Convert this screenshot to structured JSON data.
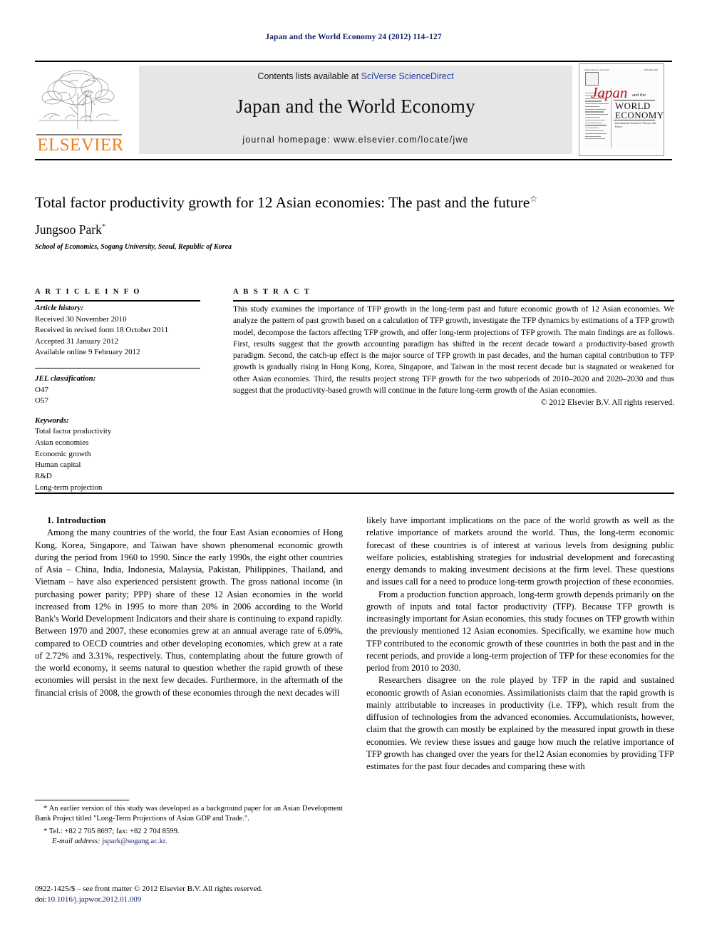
{
  "running_head": "Japan and the World Economy 24 (2012) 114–127",
  "masthead": {
    "contents_prefix": "Contents lists available at ",
    "contents_link": "SciVerse ScienceDirect",
    "journal_title": "Japan and the World Economy",
    "homepage": "journal homepage: www.elsevier.com/locate/jwe",
    "publisher_word": "ELSEVIER",
    "publisher_color": "#f07f1a",
    "link_color": "#2b3f9e",
    "cover": {
      "issue_line_left": "Volume 24  Issue 2  June 2012",
      "issue_line_right": "ISSN 0922-1425",
      "title_script": "Japan",
      "title_andthe": "and the",
      "title_world": "WORLD",
      "title_economy": "ECONOMY",
      "title_sub": "International Journal of Theory and Policy",
      "script_color": "#b5121b"
    }
  },
  "article": {
    "title": "Total factor productivity growth for 12 Asian economies: The past and the future",
    "title_marker": "☆",
    "author": "Jungsoo Park",
    "author_marker": "*",
    "affiliation": "School of Economics, Sogang University, Seoul, Republic of Korea"
  },
  "info": {
    "header": "A R T I C L E   I N F O",
    "history_label": "Article history:",
    "history": [
      "Received 30 November 2010",
      "Received in revised form 18 October 2011",
      "Accepted 31 January 2012",
      "Available online 9 February 2012"
    ],
    "jel_label": "JEL classification:",
    "jel": [
      "O47",
      "O57"
    ],
    "keywords_label": "Keywords:",
    "keywords": [
      "Total factor productivity",
      "Asian economies",
      "Economic growth",
      "Human capital",
      "R&D",
      "Long-term projection"
    ]
  },
  "abstract": {
    "header": "A B S T R A C T",
    "text": "This study examines the importance of TFP growth in the long-term past and future economic growth of 12 Asian economies. We analyze the pattern of past growth based on a calculation of TFP growth, investigate the TFP dynamics by estimations of a TFP growth model, decompose the factors affecting TFP growth, and offer long-term projections of TFP growth. The main findings are as follows. First, results suggest that the growth accounting paradigm has shifted in the recent decade toward a productivity-based growth paradigm. Second, the catch-up effect is the major source of TFP growth in past decades, and the human capital contribution to TFP growth is gradually rising in Hong Kong, Korea, Singapore, and Taiwan in the most recent decade but is stagnated or weakened for other Asian economies. Third, the results project strong TFP growth for the two subperiods of 2010–2020 and 2020–2030 and thus suggest that the productivity-based growth will continue in the future long-term growth of the Asian economies.",
    "copyright": "© 2012 Elsevier B.V. All rights reserved."
  },
  "body": {
    "section_heading": "1. Introduction",
    "left_paragraphs": [
      "Among the many countries of the world, the four East Asian economies of Hong Kong, Korea, Singapore, and Taiwan have shown phenomenal economic growth during the period from 1960 to 1990. Since the early 1990s, the eight other countries of Asia – China, India, Indonesia, Malaysia, Pakistan, Philippines, Thailand, and Vietnam – have also experienced persistent growth. The gross national income (in purchasing power parity; PPP) share of these 12 Asian economies in the world increased from 12% in 1995 to more than 20% in 2006 according to the World Bank's World Development Indicators and their share is continuing to expand rapidly. Between 1970 and 2007, these economies grew at an annual average rate of 6.09%, compared to OECD countries and other developing economies, which grew at a rate of 2.72% and 3.31%, respectively. Thus, contemplating about the future growth of the world economy, it seems natural to question whether the rapid growth of these economies will persist in the next few decades. Furthermore, in the aftermath of the financial crisis of 2008, the growth of these economies through the next decades will"
    ],
    "right_paragraphs": [
      "likely have important implications on the pace of the world growth as well as the relative importance of markets around the world. Thus, the long-term economic forecast of these countries is of interest at various levels from designing public welfare policies, establishing strategies for industrial development and forecasting energy demands to making investment decisions at the firm level. These questions and issues call for a need to produce long-term growth projection of these economies.",
      "From a production function approach, long-term growth depends primarily on the growth of inputs and total factor productivity (TFP). Because TFP growth is increasingly important for Asian economies, this study focuses on TFP growth within the previously mentioned 12 Asian economies. Specifically, we examine how much TFP contributed to the economic growth of these countries in both the past and in the recent periods, and provide a long-term projection of TFP for these economies for the period from 2010 to 2030.",
      "Researchers disagree on the role played by TFP in the rapid and sustained economic growth of Asian economies. Assimilationists claim that the rapid growth is mainly attributable to increases in productivity (i.e. TFP), which result from the diffusion of technologies from the advanced economies. Accumulationists, however, claim that the growth can mostly be explained by the measured input growth in these economies. We review these issues and gauge how much the relative importance of TFP growth has changed over the years for the12 Asian economies by providing TFP estimates for the past four decades and comparing these with"
    ]
  },
  "footnotes": {
    "star_note": "An earlier version of this study was developed as a background paper for an Asian Development Bank Project titled \"Long-Term Projections of Asian GDP and Trade.\".",
    "star_marker": "*",
    "tel_marker": "*",
    "tel": "Tel.: +82 2 705 8697; fax: +82 2 704 8599.",
    "email_label": "E-mail address:",
    "email": "jspark@sogang.ac.kr.",
    "issn_line": "0922-1425/$ – see front matter © 2012 Elsevier B.V. All rights reserved.",
    "doi_label": "doi:",
    "doi": "10.1016/j.japwor.2012.01.009"
  }
}
